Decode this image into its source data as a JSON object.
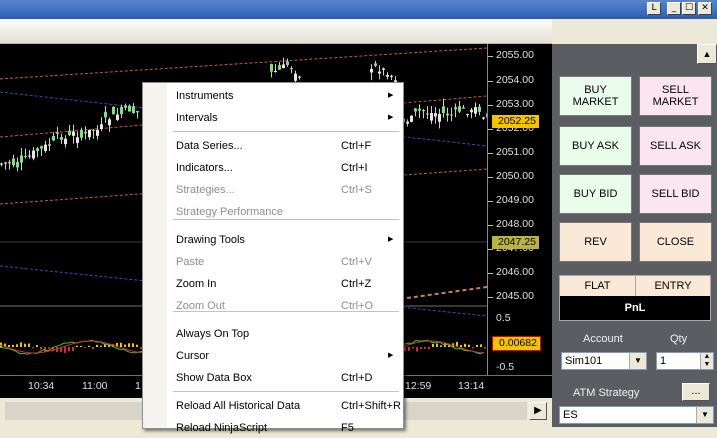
{
  "window": {
    "title": "",
    "controls": [
      "L",
      "_",
      "☐",
      "✕"
    ]
  },
  "price_axis": {
    "ticks": [
      "2055.00",
      "2054.00",
      "2053.00",
      "2052.00",
      "2051.00",
      "2050.00",
      "2049.00",
      "2048.00",
      "2047.00",
      "2046.00",
      "2045.00"
    ],
    "last_price": "2052.25",
    "marker_price": "2047.25",
    "indicator_ticks": [
      "0.5",
      "-0.5"
    ],
    "indicator_value": "0.00682"
  },
  "time_axis": {
    "labels": [
      "10:34",
      "11:00",
      "1",
      "12:59",
      "13:14"
    ]
  },
  "context_menu": {
    "items": [
      {
        "label": "Instruments",
        "shortcut": "",
        "submenu": true,
        "disabled": false
      },
      {
        "label": "Intervals",
        "shortcut": "",
        "submenu": true,
        "disabled": false
      },
      {
        "label": "Data Series...",
        "shortcut": "Ctrl+F",
        "submenu": false,
        "disabled": false
      },
      {
        "label": "Indicators...",
        "shortcut": "Ctrl+I",
        "submenu": false,
        "disabled": false
      },
      {
        "label": "Strategies...",
        "shortcut": "Ctrl+S",
        "submenu": false,
        "disabled": true
      },
      {
        "label": "Strategy Performance",
        "shortcut": "",
        "submenu": false,
        "disabled": true
      },
      {
        "label": "Drawing Tools",
        "shortcut": "",
        "submenu": true,
        "disabled": false
      },
      {
        "label": "Paste",
        "shortcut": "Ctrl+V",
        "submenu": false,
        "disabled": true
      },
      {
        "label": "Zoom In",
        "shortcut": "Ctrl+Z",
        "submenu": false,
        "disabled": false
      },
      {
        "label": "Zoom Out",
        "shortcut": "Ctrl+O",
        "submenu": false,
        "disabled": true
      },
      {
        "label": "Always On Top",
        "shortcut": "",
        "submenu": false,
        "disabled": false
      },
      {
        "label": "Cursor",
        "shortcut": "",
        "submenu": true,
        "disabled": false
      },
      {
        "label": "Show Data Box",
        "shortcut": "Ctrl+D",
        "submenu": false,
        "disabled": false
      },
      {
        "label": "Reload All Historical Data",
        "shortcut": "Ctrl+Shift+R",
        "submenu": false,
        "disabled": false
      },
      {
        "label": "Reload NinjaScript",
        "shortcut": "F5",
        "submenu": false,
        "disabled": false
      }
    ]
  },
  "order_panel": {
    "buy_market": "BUY\nMARKET",
    "sell_market": "SELL\nMARKET",
    "buy_ask": "BUY ASK",
    "sell_ask": "SELL ASK",
    "buy_bid": "BUY BID",
    "sell_bid": "SELL BID",
    "rev": "REV",
    "close": "CLOSE",
    "position": "FLAT",
    "entry": "ENTRY",
    "pnl": "PnL",
    "account_label": "Account",
    "account_value": "Sim101",
    "qty_label": "Qty",
    "qty_value": "1",
    "atm_label": "ATM Strategy",
    "atm_button": "...",
    "atm_value": "ES"
  },
  "colors": {
    "buy_bg": "#eafcea",
    "sell_bg": "#fbe6ef",
    "neutral_bg": "#fbe9d8",
    "last_price_tag": "#f5c400",
    "marker_tag": "#b9b440",
    "indicator_tag": "#f5c400"
  },
  "icons": {
    "submenu": "triangle-right",
    "dropdown": "triangle-down",
    "scroll_right": "triangle-right",
    "panel_scroll_up": "triangle-up"
  }
}
